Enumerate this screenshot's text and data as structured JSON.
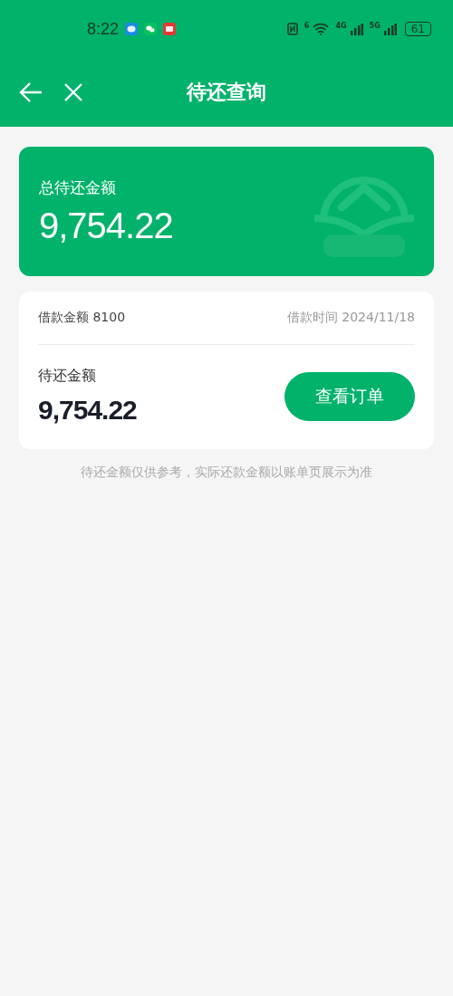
{
  "status_bar": {
    "time": "8:22",
    "wifi_label": "6",
    "networks": [
      "4G",
      "5G"
    ],
    "battery": "61"
  },
  "nav": {
    "title": "待还查询"
  },
  "summary": {
    "label": "总待还金额",
    "amount": "9,754.22"
  },
  "loan": {
    "principal": "借款金额 8100",
    "date": "借款时间 2024/11/18",
    "due_label": "待还金额",
    "due_amount": "9,754.22",
    "button": "查看订单"
  },
  "note": "待还金额仅供参考，实际还款金额以账单页展示为准"
}
